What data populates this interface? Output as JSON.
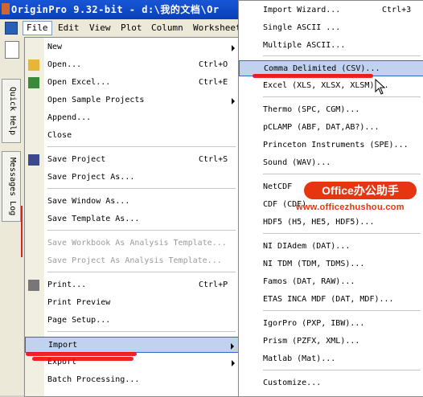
{
  "window": {
    "title": "OriginPro 9.32-bit - d:\\我的文档\\Or"
  },
  "menubar": [
    {
      "label": "File",
      "active": true
    },
    {
      "label": "Edit"
    },
    {
      "label": "View"
    },
    {
      "label": "Plot"
    },
    {
      "label": "Column"
    },
    {
      "label": "Worksheet"
    }
  ],
  "side_tabs": {
    "quick_help": "Quick Help",
    "messages_log": "Messages Log"
  },
  "file_menu": [
    {
      "label": "New",
      "submenu": true
    },
    {
      "label": "Open...",
      "shortcut": "Ctrl+O"
    },
    {
      "label": "Open Excel...",
      "shortcut": "Ctrl+E"
    },
    {
      "label": "Open Sample Projects",
      "submenu": true
    },
    {
      "label": "Append..."
    },
    {
      "label": "Close"
    },
    {
      "label": "Save Project",
      "shortcut": "Ctrl+S"
    },
    {
      "label": "Save Project As..."
    },
    {
      "label": "Save Window As..."
    },
    {
      "label": "Save Template As..."
    },
    {
      "label": "Save Workbook As Analysis Template...",
      "disabled": true
    },
    {
      "label": "Save Project As Analysis Template...",
      "disabled": true
    },
    {
      "label": "Print...",
      "shortcut": "Ctrl+P"
    },
    {
      "label": "Print Preview"
    },
    {
      "label": "Page Setup..."
    },
    {
      "label": "Import",
      "submenu": true
    },
    {
      "label": "Export",
      "submenu": true
    },
    {
      "label": "Batch Processing..."
    }
  ],
  "import_menu": [
    {
      "label": "Import Wizard...",
      "shortcut": "Ctrl+3"
    },
    {
      "label": "Single ASCII ..."
    },
    {
      "label": "Multiple ASCII..."
    },
    {
      "label": "Comma Delimited (CSV)..."
    },
    {
      "label": "Excel (XLS, XLSX, XLSM)..."
    },
    {
      "label": "Thermo (SPC, CGM)..."
    },
    {
      "label": "pCLAMP (ABF, DAT,AB?)..."
    },
    {
      "label": "Princeton Instruments (SPE)..."
    },
    {
      "label": "Sound (WAV)..."
    },
    {
      "label": "NetCDF"
    },
    {
      "label": "CDF (CDF)"
    },
    {
      "label": "HDF5 (H5, HE5, HDF5)..."
    },
    {
      "label": "NI DIAdem (DAT)..."
    },
    {
      "label": "NI TDM (TDM, TDMS)..."
    },
    {
      "label": "Famos (DAT, RAW)..."
    },
    {
      "label": "ETAS INCA MDF (DAT, MDF)..."
    },
    {
      "label": "IgorPro (PXP, IBW)..."
    },
    {
      "label": "Prism (PZFX, XML)..."
    },
    {
      "label": "Matlab (Mat)..."
    },
    {
      "label": "Customize..."
    }
  ],
  "watermark": {
    "badge": "Office办公助手",
    "url": "www.officezhushou.com"
  },
  "colors": {
    "highlight": "#c1d2ee",
    "title_bar": "#0a3fb8",
    "watermark": "#e53511"
  }
}
